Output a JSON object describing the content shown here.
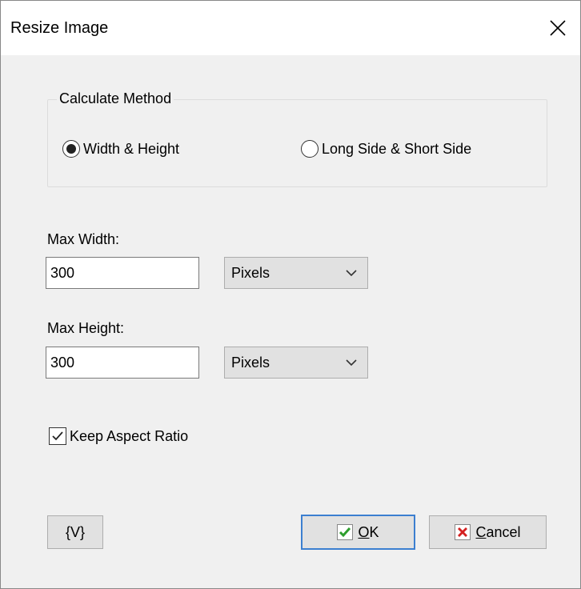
{
  "window": {
    "title": "Resize Image",
    "close_icon": "close-icon"
  },
  "calculate_method": {
    "legend": "Calculate Method",
    "options": [
      {
        "label": "Width & Height",
        "selected": true
      },
      {
        "label": "Long Side & Short Side",
        "selected": false
      }
    ]
  },
  "max_width": {
    "label": "Max Width:",
    "value": "300",
    "unit": "Pixels"
  },
  "max_height": {
    "label": "Max Height:",
    "value": "300",
    "unit": "Pixels"
  },
  "keep_aspect_ratio": {
    "label": "Keep Aspect Ratio",
    "checked": true
  },
  "buttons": {
    "variables": "{V}",
    "ok": "OK",
    "cancel": "Cancel"
  },
  "colors": {
    "ok_check": "#2e9e2e",
    "cancel_x": "#d42020",
    "default_border": "#3c7fd0"
  }
}
